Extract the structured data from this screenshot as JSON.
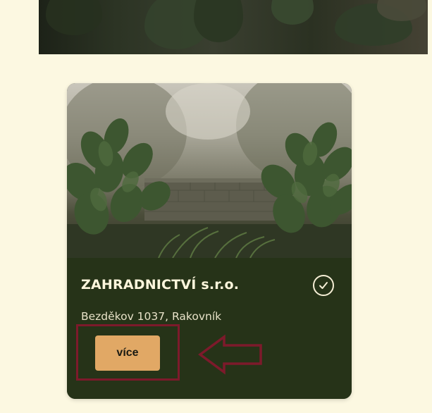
{
  "card": {
    "title": "ZAHRADNICTVÍ s.r.o.",
    "address": "Bezděkov 1037, Rakovník",
    "button_label": "více",
    "verified_icon": "check-circle-icon"
  },
  "colors": {
    "page_background": "#fcf8e1",
    "card_background": "#263318",
    "button_background": "#e1a865",
    "annotation": "#7d1a2b"
  }
}
